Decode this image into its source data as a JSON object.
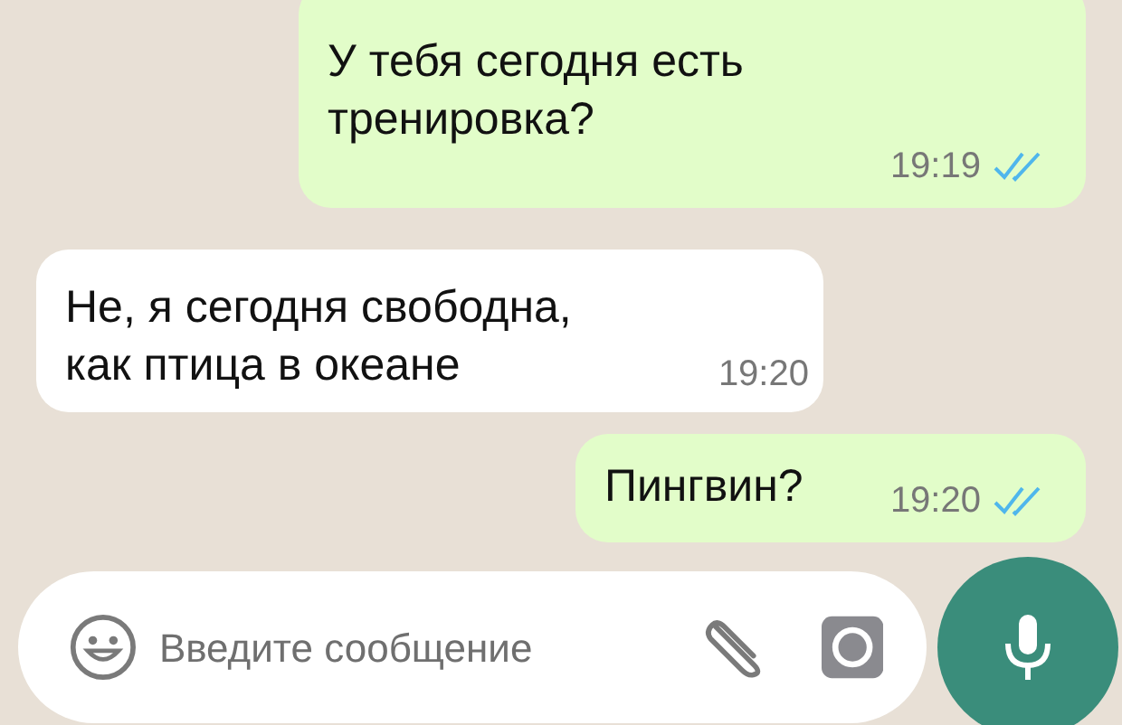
{
  "messages": [
    {
      "kind": "outgoing",
      "lines": [
        "У тебя сегодня есть",
        "тренировка?"
      ],
      "time": "19:19",
      "read": true
    },
    {
      "kind": "incoming",
      "lines": [
        "Не, я сегодня свободна,",
        "как птица в океане"
      ],
      "time": "19:20"
    },
    {
      "kind": "outgoing",
      "lines": [
        "Пингвин?"
      ],
      "time": "19:20",
      "read": true
    }
  ],
  "composer": {
    "placeholder": "Введите сообщение"
  }
}
